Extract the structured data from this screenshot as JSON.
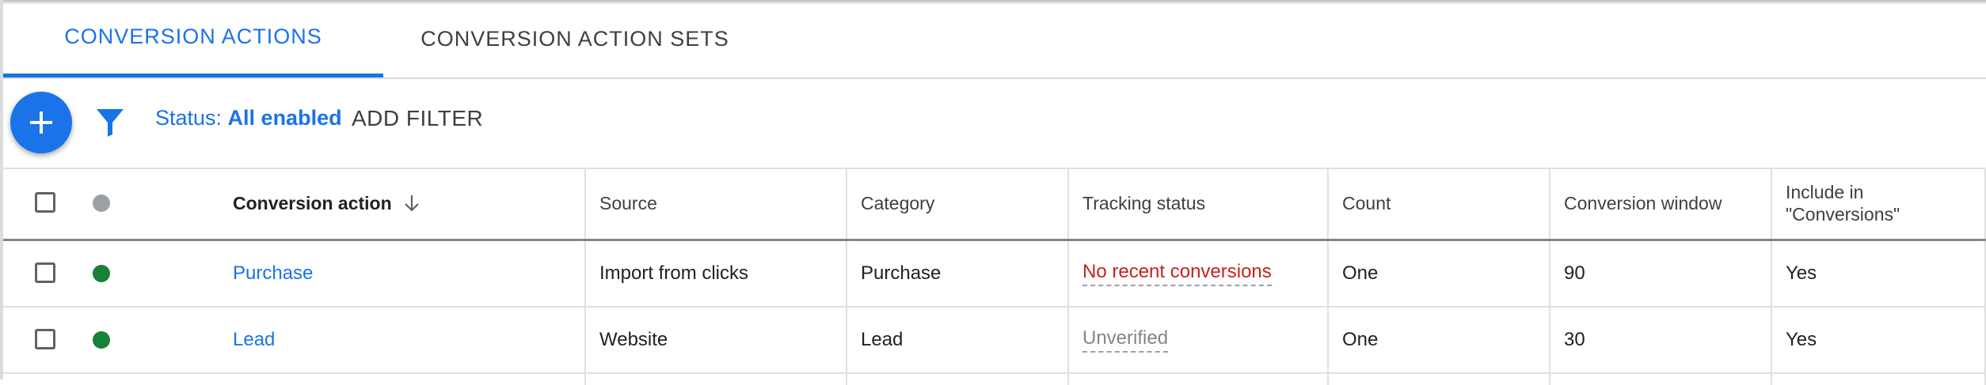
{
  "tabs": [
    {
      "label": "CONVERSION ACTIONS",
      "active": true
    },
    {
      "label": "CONVERSION ACTION SETS",
      "active": false
    }
  ],
  "toolbar": {
    "add_icon": "plus-icon",
    "filter_icon": "funnel-icon",
    "status_prefix": "Status: ",
    "status_value": "All enabled",
    "add_filter_label": "ADD FILTER"
  },
  "table": {
    "columns": {
      "name": "Conversion action",
      "source": "Source",
      "category": "Category",
      "tracking": "Tracking status",
      "count": "Count",
      "window": "Conversion window",
      "include_line1": "Include in",
      "include_line2": "\"Conversions\""
    },
    "rows": [
      {
        "name": "Purchase",
        "source": "Import from clicks",
        "category": "Purchase",
        "tracking": "No recent conversions",
        "count": "One",
        "window": "90",
        "include": "Yes",
        "status_color": "#188038"
      },
      {
        "name": "Lead",
        "source": "Website",
        "category": "Lead",
        "tracking": "Unverified",
        "count": "One",
        "window": "30",
        "include": "Yes",
        "status_color": "#188038"
      }
    ]
  },
  "colors": {
    "accent": "#1a73e8",
    "error": "#c5221f",
    "enabled": "#188038"
  }
}
